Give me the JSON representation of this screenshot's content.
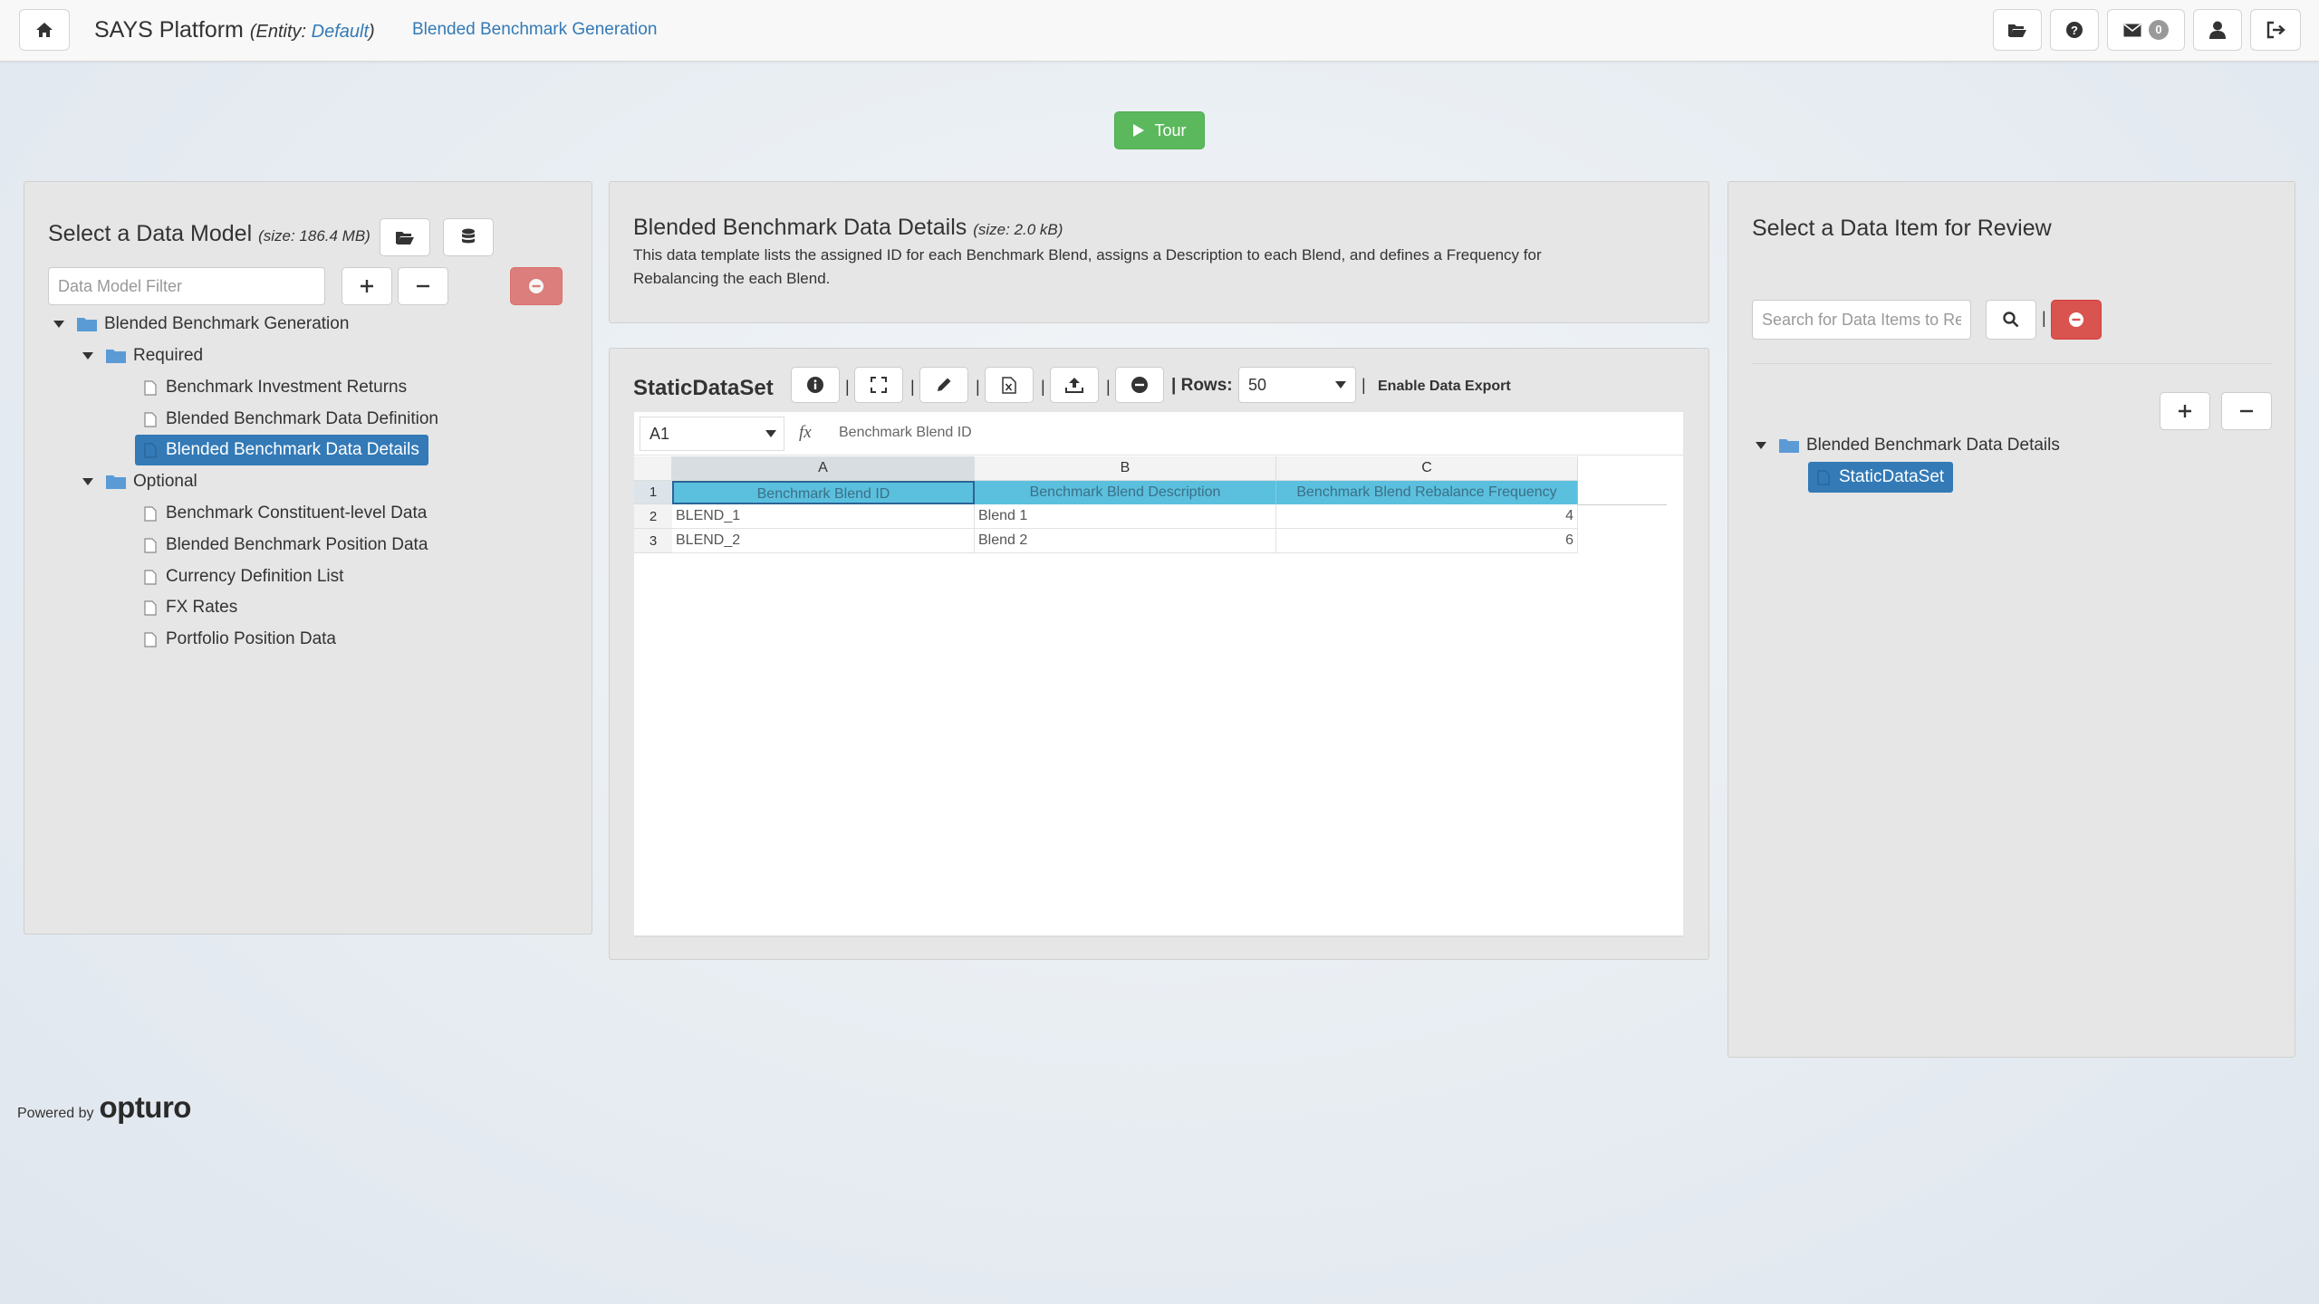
{
  "navbar": {
    "app_title": "SAYS Platform",
    "entity_label": "(Entity: ",
    "entity_value": "Default",
    "entity_close": ")",
    "breadcrumb": "Blended Benchmark Generation",
    "messages_count": "0"
  },
  "tour": {
    "label": "Tour"
  },
  "left_panel": {
    "title": "Select a Data Model",
    "size": "(size: 186.4 MB)",
    "filter_placeholder": "Data Model Filter",
    "tree": {
      "root": "Blended Benchmark Generation",
      "required_label": "Required",
      "required_items": [
        "Benchmark Investment Returns",
        "Blended Benchmark Data Definition",
        "Blended Benchmark Data Details"
      ],
      "optional_label": "Optional",
      "optional_items": [
        "Benchmark Constituent-level Data",
        "Blended Benchmark Position Data",
        "Currency Definition List",
        "FX Rates",
        "Portfolio Position Data"
      ],
      "selected": "Blended Benchmark Data Details"
    }
  },
  "details_panel": {
    "title": "Blended Benchmark Data Details",
    "size": "(size: 2.0 kB)",
    "description_line1": "This data template lists the assigned ID for each Benchmark Blend, assigns a Description to each Blend, and defines a Frequency for",
    "description_line2": "Rebalancing the each Blend."
  },
  "dataset_panel": {
    "title": "StaticDataSet",
    "rows_label": "Rows:",
    "rows_value": "50",
    "export_label": "Enable Data Export",
    "separator": "|",
    "cell_ref": "A1",
    "fx_label": "fx",
    "formula_value": "Benchmark Blend ID",
    "columns": [
      "A",
      "B",
      "C"
    ],
    "row_numbers": [
      "1",
      "2",
      "3"
    ],
    "headers": [
      "Benchmark Blend ID",
      "Benchmark Blend Description",
      "Benchmark Blend Rebalance Frequency"
    ],
    "rows": [
      [
        "BLEND_1",
        "Blend 1",
        "4"
      ],
      [
        "BLEND_2",
        "Blend 2",
        "6"
      ]
    ]
  },
  "right_panel": {
    "title": "Select a Data Item for Review",
    "search_placeholder": "Search for Data Items to Review",
    "tree_root": "Blended Benchmark Data Details",
    "tree_selected": "StaticDataSet"
  },
  "footer": {
    "powered_by": "Powered by",
    "brand": "opturo"
  },
  "colors": {
    "primary": "#337ab7",
    "success": "#5cb85c",
    "danger": "#d9534f",
    "info": "#5bc0de"
  }
}
